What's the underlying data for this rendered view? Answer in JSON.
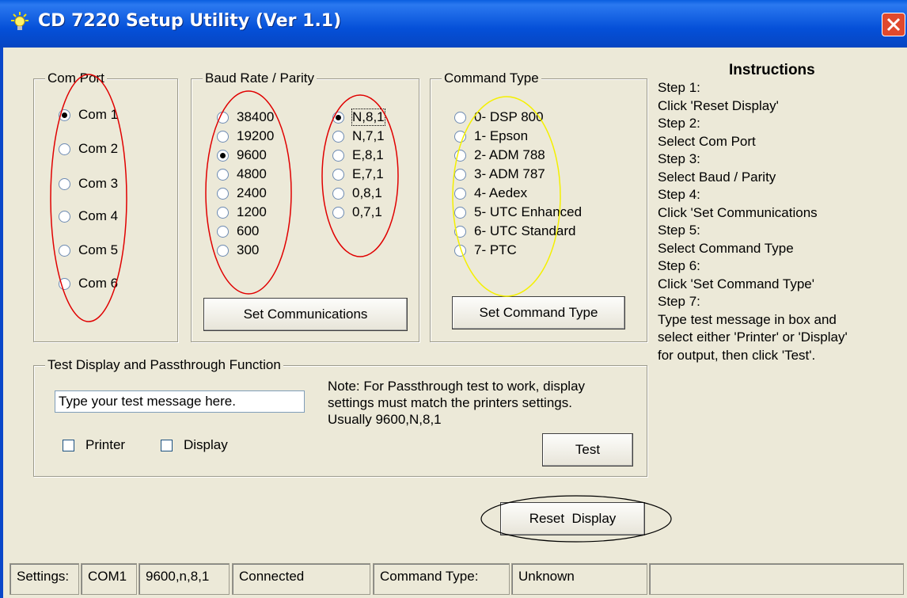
{
  "window": {
    "title": "CD 7220 Setup Utility (Ver 1.1)",
    "app_icon": "lightbulb-icon",
    "close_icon": "close-icon"
  },
  "com_port": {
    "legend": "Com Port",
    "options": [
      "Com 1",
      "Com 2",
      "Com 3",
      "Com 4",
      "Com 5",
      "Com 6"
    ],
    "selected": "Com 1"
  },
  "baud_parity": {
    "legend": "Baud Rate / Parity",
    "baud_options": [
      "38400",
      "19200",
      "9600",
      "4800",
      "2400",
      "1200",
      "600",
      "300"
    ],
    "baud_selected": "9600",
    "parity_options": [
      "N,8,1",
      "N,7,1",
      "E,8,1",
      "E,7,1",
      "0,8,1",
      "0,7,1"
    ],
    "parity_selected": "N,8,1",
    "set_button": "Set Communications"
  },
  "command_type": {
    "legend": "Command Type",
    "options": [
      "0- DSP 800",
      "1- Epson",
      "2- ADM 788",
      "3- ADM 787",
      "4- Aedex",
      "5- UTC Enhanced",
      "6- UTC Standard",
      "7- PTC"
    ],
    "set_button": "Set Command Type"
  },
  "instructions": {
    "heading": "Instructions",
    "lines": [
      "Step 1:",
      "Click 'Reset Display'",
      "Step 2:",
      "Select Com Port",
      "Step 3:",
      "Select Baud / Parity",
      "Step 4:",
      "Click 'Set Communications",
      "Step 5:",
      "Select Command Type",
      "Step 6:",
      "Click 'Set Command Type'",
      "Step 7:",
      "Type test message in box and",
      "select either 'Printer' or 'Display'",
      "for output, then click 'Test'."
    ]
  },
  "test": {
    "legend": "Test Display and Passthrough Function",
    "message_value": "Type your test message here.",
    "note_lines": [
      "Note: For Passthrough test to work, display",
      "settings must match the printers settings.",
      "Usually 9600,N,8,1"
    ],
    "printer_label": "Printer",
    "display_label": "Display",
    "test_button": "Test"
  },
  "reset_button": "Reset  Display",
  "status": [
    "Settings:",
    "COM1",
    "9600,n,8,1",
    "Connected",
    "Command Type:",
    "Unknown"
  ],
  "colors": {
    "title_bar": "#0550d8",
    "annotation_red": "#e00000",
    "annotation_yellow": "#f4f000"
  }
}
